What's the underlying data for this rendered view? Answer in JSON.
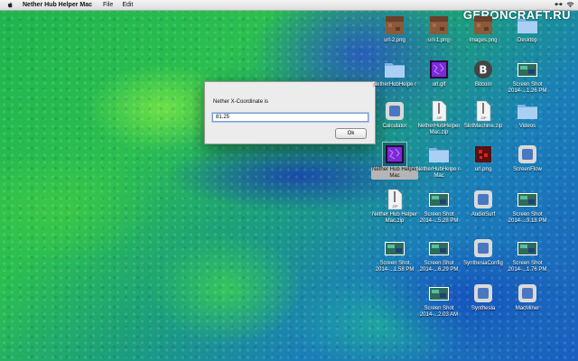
{
  "menubar": {
    "app_name": "Nether Hub Helper Mac",
    "items": [
      "File",
      "Edit"
    ]
  },
  "watermark": "GERONCRAFT.RU",
  "dialog": {
    "prompt": "Nether X-Coordinate is",
    "value": "81.25",
    "ok_label": "Ok"
  },
  "icons": [
    {
      "label": "url-2.png",
      "type": "minecraft-block"
    },
    {
      "label": "url-1.png",
      "type": "minecraft-block"
    },
    {
      "label": "images.png",
      "type": "minecraft-block"
    },
    {
      "label": "Desktop",
      "type": "folder"
    },
    {
      "label": "NetherHubHelpe r",
      "type": "folder"
    },
    {
      "label": "url.gif",
      "type": "portal"
    },
    {
      "label": "Bitcoin",
      "type": "bitcoin"
    },
    {
      "label": "Screen Shot 2014-...1.26 PM",
      "type": "screenshot"
    },
    {
      "label": "Calculator",
      "type": "app"
    },
    {
      "label": "NetherHubHelper Mac.zip",
      "type": "zip"
    },
    {
      "label": "SlotMachine.zip",
      "type": "zip"
    },
    {
      "label": "Videos",
      "type": "folder"
    },
    {
      "label": "Nether Hub Helper Mac",
      "type": "portal"
    },
    {
      "label": "NetherHubHelpe r-Mac",
      "type": "folder"
    },
    {
      "label": "url.png",
      "type": "redstone"
    },
    {
      "label": "ScreenFlow",
      "type": "app"
    },
    {
      "label": "Nether Hub Helper Mac.zip",
      "type": "zip"
    },
    {
      "label": "Screen Shot 2014-...5.28 PM",
      "type": "screenshot"
    },
    {
      "label": "AudioSurf",
      "type": "app"
    },
    {
      "label": "Screen Shot 2014-...9.18 PM",
      "type": "screenshot"
    },
    {
      "label": "Screen Shot 2014-...1.58 PM",
      "type": "screenshot"
    },
    {
      "label": "Screen Shot 2014-...6.29 PM",
      "type": "screenshot"
    },
    {
      "label": "SynthesiaConfig",
      "type": "app"
    },
    {
      "label": "Screen Shot 2014-...1.76 PM",
      "type": "screenshot"
    },
    {
      "label": "Screen Shot 2014-...2.03 AM",
      "type": "screenshot"
    },
    {
      "label": "Synthesia",
      "type": "app"
    },
    {
      "label": "MacMiner",
      "type": "app"
    }
  ]
}
